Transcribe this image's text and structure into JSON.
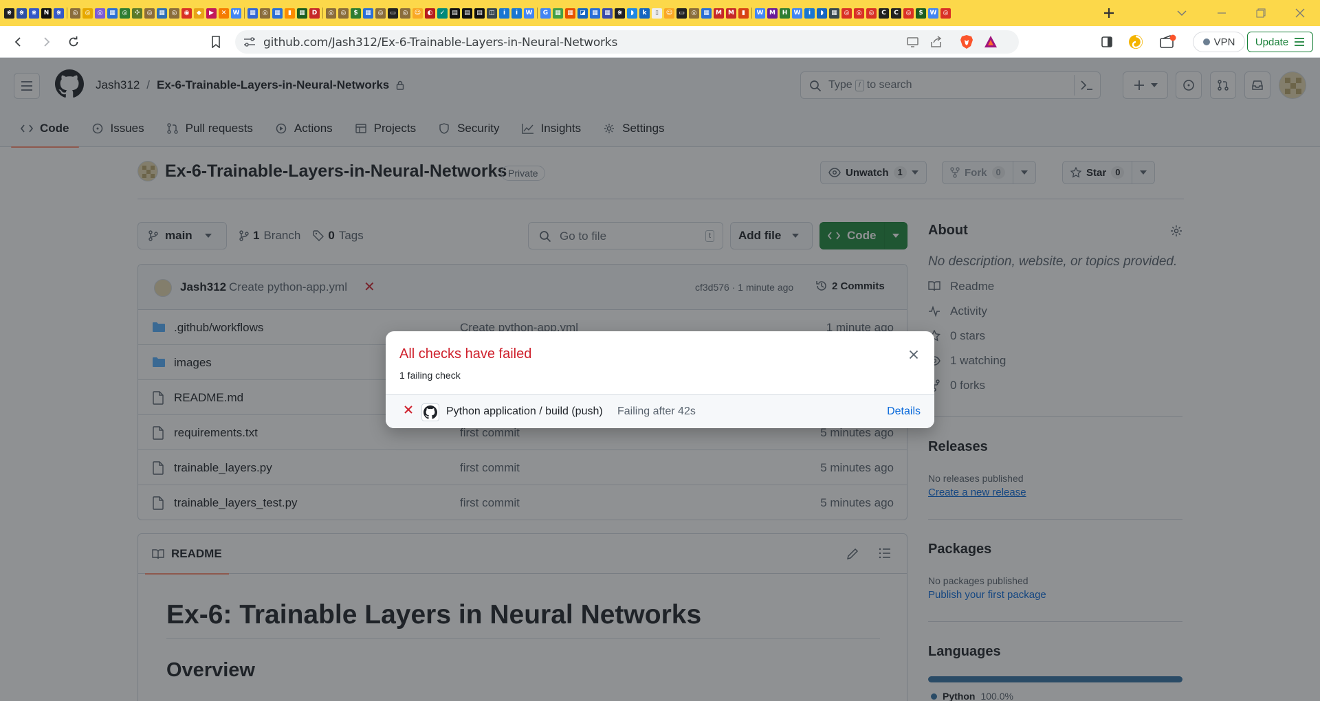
{
  "browser": {
    "url": "github.com/Jash312/Ex-6-Trainable-Layers-in-Neural-Networks",
    "vpn_label": "VPN",
    "update_label": "Update",
    "tab_favicons": [
      {
        "color": "#202124",
        "glyph": "⋇"
      },
      {
        "color": "#2b4fa5",
        "glyph": "⋇"
      },
      {
        "color": "#3559c7",
        "glyph": "⋇"
      },
      {
        "color": "#111111",
        "glyph": "N"
      },
      {
        "color": "#3559c7",
        "glyph": "⋇"
      },
      {
        "sep": true
      },
      {
        "color": "#8a6d3b",
        "glyph": "◎"
      },
      {
        "color": "#e6a800",
        "glyph": "◎"
      },
      {
        "color": "#7b5bd6",
        "glyph": "◎"
      },
      {
        "color": "#2b6fd6",
        "glyph": "▦"
      },
      {
        "color": "#2e7d32",
        "glyph": "◎"
      },
      {
        "color": "#5b7a29",
        "glyph": "✣"
      },
      {
        "color": "#8a6d3b",
        "glyph": "◎"
      },
      {
        "color": "#2f6fb5",
        "glyph": "▦"
      },
      {
        "color": "#8a6d3b",
        "glyph": "◎"
      },
      {
        "color": "#d93025",
        "glyph": "◉"
      },
      {
        "color": "#e8a317",
        "glyph": "◆"
      },
      {
        "color": "#c2185b",
        "glyph": "▶"
      },
      {
        "color": "#f57c00",
        "glyph": "✕"
      },
      {
        "color": "#4285f4",
        "glyph": "W"
      },
      {
        "sep": true
      },
      {
        "color": "#3367d6",
        "glyph": "▦"
      },
      {
        "color": "#8a6d3b",
        "glyph": "◎"
      },
      {
        "color": "#2b6fd6",
        "glyph": "▦"
      },
      {
        "color": "#fb8c00",
        "glyph": "▮"
      },
      {
        "color": "#1b5e20",
        "glyph": "▦"
      },
      {
        "color": "#c62828",
        "glyph": "D"
      },
      {
        "sep": true
      },
      {
        "color": "#8a6d3b",
        "glyph": "◎"
      },
      {
        "color": "#8a6d3b",
        "glyph": "◎"
      },
      {
        "color": "#2e7d32",
        "glyph": "$"
      },
      {
        "color": "#2b6fd6",
        "glyph": "▦"
      },
      {
        "color": "#8a6d3b",
        "glyph": "◎"
      },
      {
        "color": "#222222",
        "glyph": "▭"
      },
      {
        "color": "#8a6d3b",
        "glyph": "◎"
      },
      {
        "color": "#f9a825",
        "glyph": "☺"
      },
      {
        "color": "#b71c1c",
        "glyph": "◐"
      },
      {
        "color": "#00897b",
        "glyph": "✓"
      },
      {
        "color": "#111111",
        "glyph": "▤"
      },
      {
        "color": "#111111",
        "glyph": "▤"
      },
      {
        "color": "#111111",
        "glyph": "▤"
      },
      {
        "color": "#37474f",
        "glyph": "◫"
      },
      {
        "color": "#1976d2",
        "glyph": "i"
      },
      {
        "color": "#1976d2",
        "glyph": "i"
      },
      {
        "color": "#4285f4",
        "glyph": "W"
      },
      {
        "sep": true
      },
      {
        "color": "#4285f4",
        "glyph": "G"
      },
      {
        "color": "#43a047",
        "glyph": "▦"
      },
      {
        "color": "#e65100",
        "glyph": "▦"
      },
      {
        "color": "#1565c0",
        "glyph": "◪"
      },
      {
        "color": "#2b6fd6",
        "glyph": "▦"
      },
      {
        "color": "#3949ab",
        "glyph": "▦"
      },
      {
        "color": "#202124",
        "glyph": "⋇"
      },
      {
        "color": "#1e88e5",
        "glyph": "◗"
      },
      {
        "color": "#1565c0",
        "glyph": "k"
      },
      {
        "color": "#eeeeee",
        "glyph": "▯"
      },
      {
        "color": "#f9a825",
        "glyph": "☺"
      },
      {
        "color": "#212121",
        "glyph": "▭"
      },
      {
        "color": "#8a6d3b",
        "glyph": "◎"
      },
      {
        "color": "#2b6fd6",
        "glyph": "▦"
      },
      {
        "color": "#c62828",
        "glyph": "M"
      },
      {
        "color": "#c62828",
        "glyph": "M"
      },
      {
        "color": "#d84315",
        "glyph": "▮"
      },
      {
        "sep": true
      },
      {
        "color": "#4285f4",
        "glyph": "W"
      },
      {
        "color": "#6a1b9a",
        "glyph": "M"
      },
      {
        "color": "#2e7d32",
        "glyph": "H"
      },
      {
        "color": "#4285f4",
        "glyph": "W"
      },
      {
        "color": "#1976d2",
        "glyph": "i"
      },
      {
        "color": "#1565c0",
        "glyph": "◗"
      },
      {
        "color": "#37474f",
        "glyph": "▦"
      },
      {
        "color": "#d93025",
        "glyph": "◎"
      },
      {
        "color": "#d93025",
        "glyph": "◎"
      },
      {
        "color": "#d93025",
        "glyph": "◎"
      },
      {
        "color": "#212121",
        "glyph": "C"
      },
      {
        "color": "#212121",
        "glyph": "C"
      },
      {
        "color": "#d93025",
        "glyph": "◎"
      },
      {
        "color": "#1b5e20",
        "glyph": "$"
      },
      {
        "color": "#4285f4",
        "glyph": "W"
      },
      {
        "color": "#d93025",
        "glyph": "◎"
      }
    ]
  },
  "header": {
    "owner": "Jash312",
    "separator": "/",
    "repo": "Ex-6-Trainable-Layers-in-Neural-Networks",
    "search_prefix": "Type",
    "search_key": "/",
    "search_suffix": "to search"
  },
  "repo_nav": [
    {
      "label": "Code",
      "icon": "code-icon",
      "active": true
    },
    {
      "label": "Issues",
      "icon": "issue-icon"
    },
    {
      "label": "Pull requests",
      "icon": "pull-request-icon"
    },
    {
      "label": "Actions",
      "icon": "play-icon"
    },
    {
      "label": "Projects",
      "icon": "table-icon"
    },
    {
      "label": "Security",
      "icon": "shield-icon"
    },
    {
      "label": "Insights",
      "icon": "graph-icon"
    },
    {
      "label": "Settings",
      "icon": "gear-icon"
    }
  ],
  "repo_title": {
    "name": "Ex-6-Trainable-Layers-in-Neural-Networks",
    "visibility": "Private",
    "unwatch_label": "Unwatch",
    "watch_count": "1",
    "fork_label": "Fork",
    "fork_count": "0",
    "star_label": "Star",
    "star_count": "0"
  },
  "branch_row": {
    "branch": "main",
    "branch_count": "1",
    "branch_word": "Branch",
    "tag_count": "0",
    "tag_word": "Tags",
    "goto_placeholder": "Go to file",
    "goto_key": "t",
    "add_file_label": "Add file",
    "code_label": "Code"
  },
  "latest_commit": {
    "author": "Jash312",
    "message": "Create python-app.yml",
    "status_mark": "✕",
    "meta": "cf3d576 · 1 minute ago",
    "commits_label": "2 Commits"
  },
  "files": [
    {
      "name": ".github/workflows",
      "type": "folder",
      "message": "Create python-app.yml",
      "time": "1 minute ago"
    },
    {
      "name": "images",
      "type": "folder",
      "message": "",
      "time": ""
    },
    {
      "name": "README.md",
      "type": "file",
      "message": "",
      "time": ""
    },
    {
      "name": "requirements.txt",
      "type": "file",
      "message": "first commit",
      "time": "5 minutes ago"
    },
    {
      "name": "trainable_layers.py",
      "type": "file",
      "message": "first commit",
      "time": "5 minutes ago"
    },
    {
      "name": "trainable_layers_test.py",
      "type": "file",
      "message": "first commit",
      "time": "5 minutes ago"
    }
  ],
  "readme": {
    "tab_label": "README",
    "h1": "Ex-6: Trainable Layers in Neural Networks",
    "h2": "Overview"
  },
  "sidebar": {
    "about_title": "About",
    "about_desc": "No description, website, or topics provided.",
    "about_items": [
      {
        "label": "Readme",
        "icon": "book-icon"
      },
      {
        "label": "Activity",
        "icon": "pulse-icon"
      },
      {
        "label": "0 stars",
        "icon": "star-icon"
      },
      {
        "label": "1 watching",
        "icon": "eye-icon"
      },
      {
        "label": "0 forks",
        "icon": "fork-icon"
      }
    ],
    "releases_title": "Releases",
    "releases_text": "No releases published",
    "releases_link": "Create a new release",
    "packages_title": "Packages",
    "packages_text": "No packages published",
    "packages_link": "Publish your first package",
    "languages_title": "Languages",
    "language_name": "Python",
    "language_pct": "100.0%"
  },
  "dialog": {
    "title": "All checks have failed",
    "subtitle": "1 failing check",
    "check_name": "Python application / build (push)",
    "check_status": "Failing after 42s",
    "details_label": "Details"
  },
  "colors": {
    "accent_green": "#1f883d",
    "fail_red": "#cf222e",
    "link_blue": "#0969da",
    "python": "#3572A5"
  }
}
